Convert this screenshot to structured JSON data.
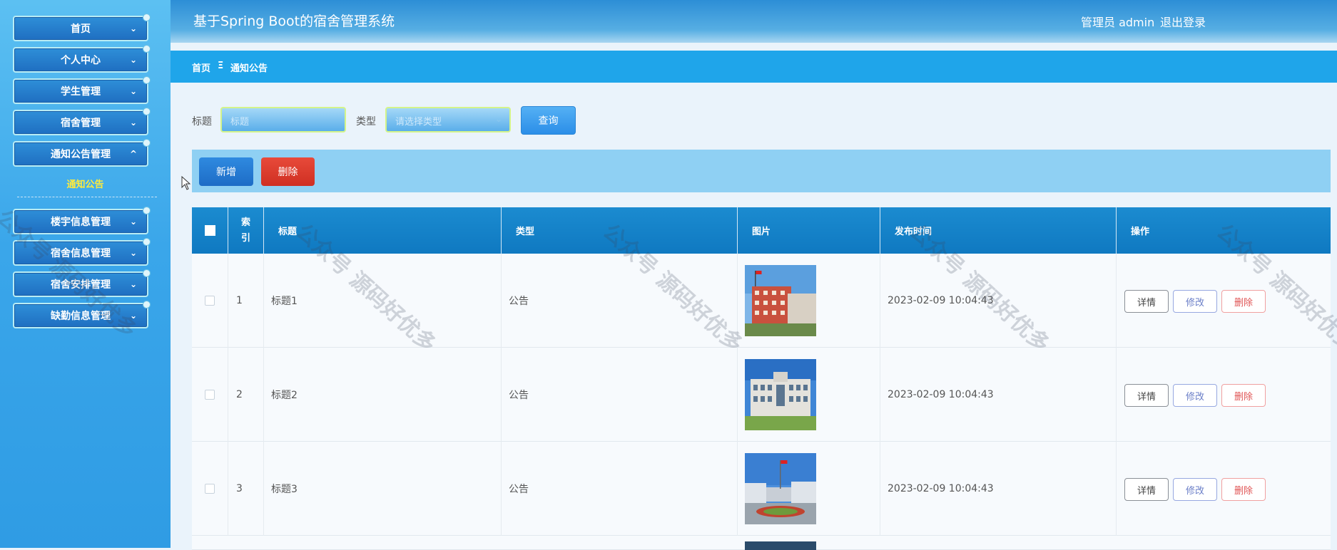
{
  "sidebar": {
    "items": [
      {
        "label": "首页"
      },
      {
        "label": "个人中心"
      },
      {
        "label": "学生管理"
      },
      {
        "label": "宿舍管理"
      },
      {
        "label": "通知公告管理"
      },
      {
        "label": "楼宇信息管理"
      },
      {
        "label": "宿舍信息管理"
      },
      {
        "label": "宿舍安排管理"
      },
      {
        "label": "缺勤信息管理"
      }
    ],
    "active_subitem": "通知公告"
  },
  "header": {
    "title": "基于Spring Boot的宿舍管理系统",
    "user": "管理员 admin",
    "logout": "退出登录"
  },
  "breadcrumb": {
    "home": "首页",
    "separator": "Ξ",
    "current": "通知公告"
  },
  "search": {
    "title_label": "标题",
    "title_placeholder": "标题",
    "type_label": "类型",
    "type_placeholder": "请选择类型",
    "query_button": "查询"
  },
  "toolbar": {
    "add_button": "新增",
    "delete_button": "删除"
  },
  "table": {
    "headers": {
      "index": "索引",
      "title": "标题",
      "type": "类型",
      "image": "图片",
      "publish_time": "发布时间",
      "actions": "操作"
    },
    "rows": [
      {
        "index": "1",
        "title": "标题1",
        "type": "公告",
        "time": "2023-02-09 10:04:43"
      },
      {
        "index": "2",
        "title": "标题2",
        "type": "公告",
        "time": "2023-02-09 10:04:43"
      },
      {
        "index": "3",
        "title": "标题3",
        "type": "公告",
        "time": "2023-02-09 10:04:43"
      }
    ],
    "row_actions": {
      "detail": "详情",
      "edit": "修改",
      "delete": "删除"
    }
  },
  "watermark": "公众号 源码好优多",
  "colors": {
    "sidebar": "#3aa6ea",
    "header": "#2c8ed6",
    "breadcrumb": "#1fa5ea",
    "table_header": "#1b8bd0",
    "add_button": "#2f8ae0",
    "delete_button": "#e84a3a",
    "active_subitem": "#ffeb3b"
  }
}
